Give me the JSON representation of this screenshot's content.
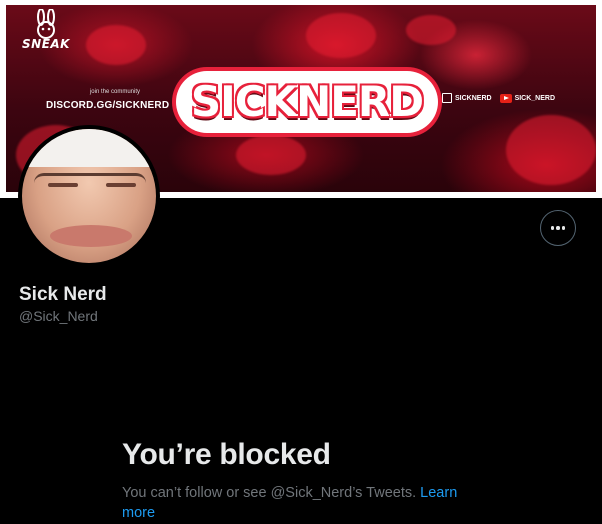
{
  "banner": {
    "brand_name": "SNEAK",
    "community_caption": "join the community",
    "community_link": "DISCORD.GG/SICKNERD",
    "logo_text": "SICKNERD",
    "socials": [
      {
        "icon": "twitch-icon",
        "label": "SICKNERD"
      },
      {
        "icon": "youtube-icon",
        "label": "SICK_NERD"
      }
    ]
  },
  "profile": {
    "display_name": "Sick Nerd",
    "handle": "@Sick_Nerd",
    "more_icon": "more-options-icon"
  },
  "blocked": {
    "title": "You’re blocked",
    "description": "You can’t follow or see @Sick_Nerd’s Tweets.",
    "link_label": "Learn more"
  },
  "colors": {
    "background": "#000000",
    "link": "#1d9bf0",
    "secondary_text": "#71767b",
    "primary_text": "#e7e9ea",
    "banner_accent": "#e7213b"
  }
}
